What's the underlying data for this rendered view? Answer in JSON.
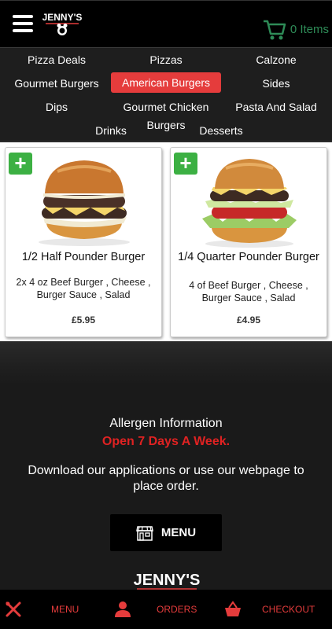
{
  "header": {
    "logo_text": "JENNY'S",
    "cart_label": "0 Items"
  },
  "categories": [
    {
      "label": "Pizza Deals"
    },
    {
      "label": "Pizzas"
    },
    {
      "label": "Calzone"
    },
    {
      "label": "Gourmet Burgers"
    },
    {
      "label": "American Burgers",
      "active": true
    },
    {
      "label": "Sides"
    },
    {
      "label": "Dips"
    },
    {
      "label": "Gourmet Chicken"
    },
    {
      "label": "Pasta And Salad"
    },
    {
      "label": "Drinks"
    },
    {
      "label": "Burgers"
    },
    {
      "label": "Desserts"
    }
  ],
  "products": [
    {
      "name": "1/2 Half Pounder Burger",
      "description": "2x 4 oz Beef Burger , Cheese , Burger Sauce , Salad",
      "price": "£5.95"
    },
    {
      "name": "1/4 Quarter Pounder Burger",
      "description": "4 of Beef Burger , Cheese , Burger Sauce , Salad",
      "price": "£4.95"
    }
  ],
  "footer": {
    "allergen": "Allergen Information",
    "open_days": "Open 7 Days A Week.",
    "download": "Download our applications or use our webpage to place order.",
    "menu_button": "MENU",
    "logo_text": "JENNY'S"
  },
  "bottom_nav": [
    {
      "label": "MENU",
      "icon": "fork-knife-icon"
    },
    {
      "label": "ORDERS",
      "icon": "user-icon"
    },
    {
      "label": "CHECKOUT",
      "icon": "basket-icon"
    }
  ],
  "colors": {
    "accent_red": "#e53c3c",
    "cart_green": "#2e8b57",
    "add_green": "#3cb043"
  }
}
